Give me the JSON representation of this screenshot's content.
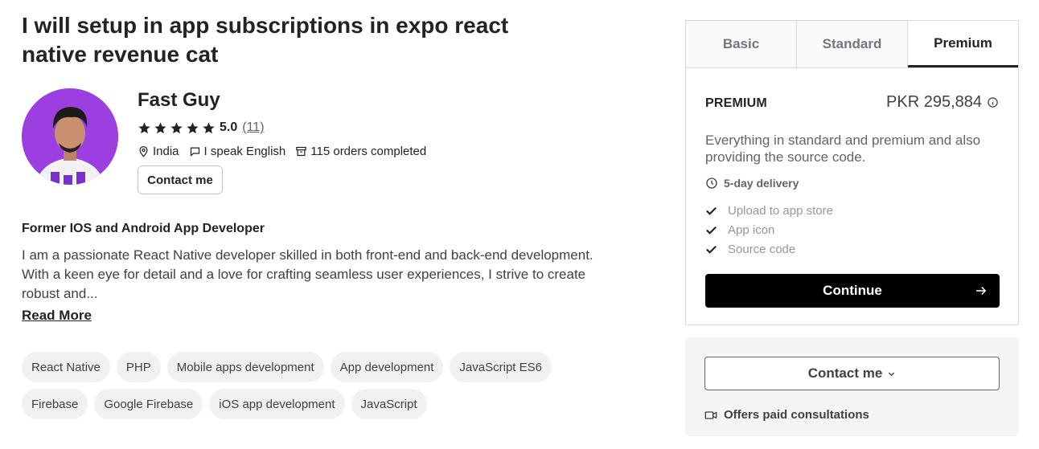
{
  "gig": {
    "title": "I will setup in app subscriptions in expo react native revenue cat"
  },
  "seller": {
    "name": "Fast Guy",
    "rating": "5.0",
    "rating_count": "(11)",
    "location": "India",
    "language": "I speak English",
    "orders": "115 orders completed",
    "contact_label": "Contact me",
    "star_color": "#222325",
    "avatar_bg": "#9b3fe0"
  },
  "about": {
    "headline": "Former IOS and Android App Developer",
    "text": "I am a passionate React Native developer skilled in both front-end and back-end development. With a keen eye for detail and a love for crafting seamless user experiences, I strive to create robust and...",
    "read_more": "Read More"
  },
  "skills": [
    "React Native",
    "PHP",
    "Mobile apps development",
    "App development",
    "JavaScript ES6",
    "Firebase",
    "Google Firebase",
    "iOS app development",
    "JavaScript"
  ],
  "packages": {
    "tabs": [
      "Basic",
      "Standard",
      "Premium"
    ],
    "active_tab": "Premium",
    "name": "PREMIUM",
    "price": "PKR 295,884",
    "description": "Everything in standard and premium and also providing the source code.",
    "delivery": "5-day delivery",
    "features": [
      "Upload to app store",
      "App icon",
      "Source code"
    ],
    "continue_label": "Continue"
  },
  "contact_card": {
    "button_label": "Contact me",
    "consultation": "Offers paid consultations"
  }
}
